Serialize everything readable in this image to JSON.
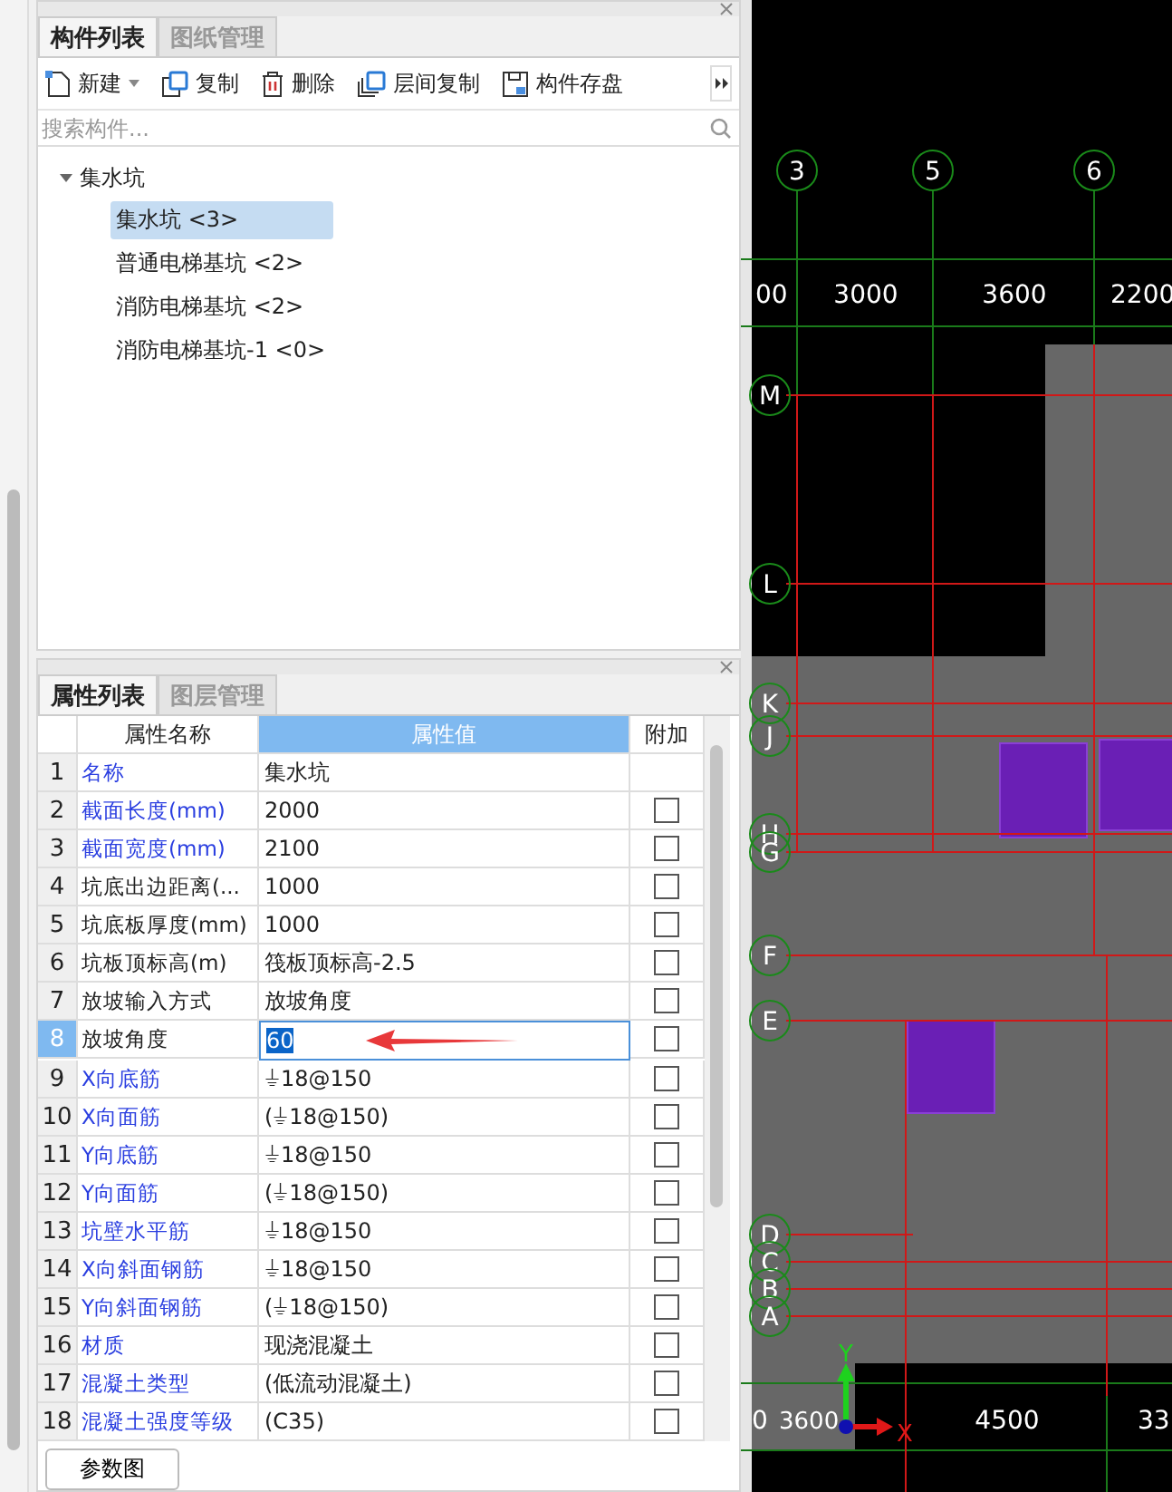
{
  "component_panel": {
    "tabs": [
      {
        "label": "构件列表",
        "selected": true
      },
      {
        "label": "图纸管理",
        "selected": false
      }
    ],
    "toolbar": [
      {
        "kind": "new",
        "label": "新建",
        "dropdown": true
      },
      {
        "kind": "copy",
        "label": "复制",
        "dropdown": false
      },
      {
        "kind": "delete",
        "label": "删除",
        "dropdown": false
      },
      {
        "kind": "floor-copy",
        "label": "层间复制",
        "dropdown": false
      },
      {
        "kind": "save",
        "label": "构件存盘",
        "dropdown": false
      }
    ],
    "search": {
      "placeholder": "搜索构件..."
    },
    "tree": [
      {
        "label": "集水坑",
        "expanded": true,
        "children": [
          {
            "label": "集水坑 <3>",
            "selected": true
          },
          {
            "label": "普通电梯基坑 <2>",
            "selected": false
          },
          {
            "label": "消防电梯基坑 <2>",
            "selected": false
          },
          {
            "label": "消防电梯基坑-1 <0>",
            "selected": false
          }
        ]
      }
    ]
  },
  "property_panel": {
    "tabs": [
      {
        "label": "属性列表",
        "selected": true
      },
      {
        "label": "图层管理",
        "selected": false
      }
    ],
    "table": {
      "columns": [
        "属性名称",
        "属性值",
        "附加"
      ],
      "rows": [
        {
          "number": "1",
          "name": "名称",
          "value": "集水坑",
          "public": true,
          "selected": false
        },
        {
          "number": "2",
          "name": "截面长度(mm)",
          "value": "2000",
          "public": true,
          "selected": false,
          "checked": false
        },
        {
          "number": "3",
          "name": "截面宽度(mm)",
          "value": "2100",
          "public": true,
          "selected": false,
          "checked": false
        },
        {
          "number": "4",
          "name": "坑底出边距离(...",
          "value": "1000",
          "public": false,
          "selected": false,
          "checked": false
        },
        {
          "number": "5",
          "name": "坑底板厚度(mm)",
          "value": "1000",
          "public": false,
          "selected": false,
          "checked": false
        },
        {
          "number": "6",
          "name": "坑板顶标高(m)",
          "value": "筏板顶标高-2.5",
          "public": false,
          "selected": false,
          "checked": false
        },
        {
          "number": "7",
          "name": "放坡输入方式",
          "value": "放坡角度",
          "public": false,
          "selected": false,
          "checked": false
        },
        {
          "number": "8",
          "name": "放坡角度",
          "value": "60",
          "public": false,
          "selected": true,
          "checked": false
        },
        {
          "number": "9",
          "name": "X向底筋",
          "value": "⏚18@150",
          "public": true,
          "selected": false,
          "checked": false
        },
        {
          "number": "10",
          "name": "X向面筋",
          "value": "(⏚18@150)",
          "public": true,
          "selected": false,
          "checked": false
        },
        {
          "number": "11",
          "name": "Y向底筋",
          "value": "⏚18@150",
          "public": true,
          "selected": false,
          "checked": false
        },
        {
          "number": "12",
          "name": "Y向面筋",
          "value": "(⏚18@150)",
          "public": true,
          "selected": false,
          "checked": false
        },
        {
          "number": "13",
          "name": "坑壁水平筋",
          "value": "⏚18@150",
          "public": true,
          "selected": false,
          "checked": false
        },
        {
          "number": "14",
          "name": "X向斜面钢筋",
          "value": "⏚18@150",
          "public": true,
          "selected": false,
          "checked": false
        },
        {
          "number": "15",
          "name": "Y向斜面钢筋",
          "value": "(⏚18@150)",
          "public": true,
          "selected": false,
          "checked": false
        },
        {
          "number": "16",
          "name": "材质",
          "value": "现浇混凝土",
          "public": true,
          "selected": false,
          "checked": false
        },
        {
          "number": "17",
          "name": "混凝土类型",
          "value": "(低流动混凝土)",
          "public": true,
          "selected": false,
          "checked": false
        },
        {
          "number": "18",
          "name": "混凝土强度等级",
          "value": "(C35)",
          "public": true,
          "selected": false,
          "checked": false
        }
      ]
    },
    "button": "参数图"
  },
  "drawing": {
    "column_axes": [
      "3",
      "5",
      "6"
    ],
    "row_axes": [
      "M",
      "L",
      "K",
      "J",
      "H",
      "G",
      "F",
      "E",
      "D",
      "C",
      "B",
      "A"
    ],
    "top_dimensions": [
      "00",
      "3000",
      "3600",
      "2200"
    ],
    "bottom_dimensions": [
      "0",
      "3600",
      "4500",
      "33"
    ],
    "axis_letters": [
      "X",
      "Y"
    ]
  }
}
